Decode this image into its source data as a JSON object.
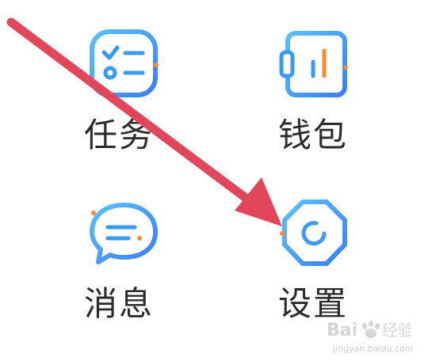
{
  "menu": {
    "items": [
      {
        "label": "任务",
        "icon": "task-checklist-icon"
      },
      {
        "label": "钱包",
        "icon": "wallet-icon"
      },
      {
        "label": "消息",
        "icon": "message-bubble-icon"
      },
      {
        "label": "设置",
        "icon": "settings-gear-icon"
      }
    ]
  },
  "colors": {
    "icon_blue": "#3fa3f5",
    "icon_accent": "#ff8a2b",
    "label_text": "#2b2b2b",
    "arrow": "#e2465a",
    "watermark": "#c9c9c9"
  },
  "watermark": {
    "brand": "Baidu 经验",
    "url": "jingyan.baidu.com"
  }
}
